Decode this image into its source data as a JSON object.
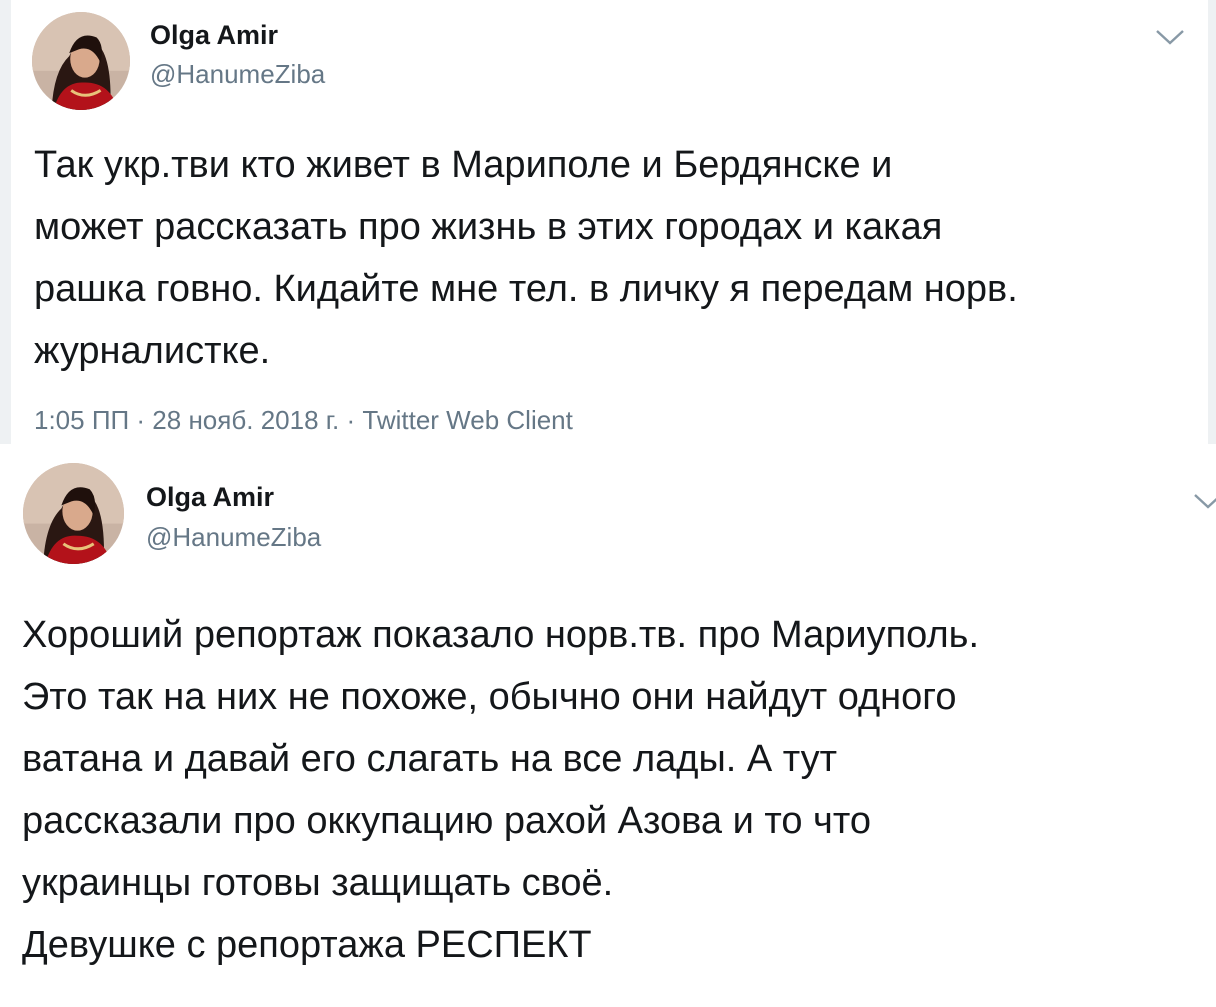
{
  "tweets": [
    {
      "author": {
        "name": "Olga Amir",
        "handle": "@HanumeZiba",
        "avatar_icon": "profile-photo"
      },
      "text": "Так укр.тви кто живет в Мариполе и Бердянске и\nможет рассказать про жизнь в этих городах и какая\nрашка говно. Кидайте мне тел. в личку я передам норв.\nжурналистке.",
      "meta": "1:05 ПП · 28 нояб. 2018 г. · Twitter Web Client",
      "menu_icon": "chevron-down-icon"
    },
    {
      "author": {
        "name": "Olga Amir",
        "handle": "@HanumeZiba",
        "avatar_icon": "profile-photo"
      },
      "text": "Хороший репортаж показало норв.тв. про Мариуполь.\nЭто так на них не похоже, обычно они найдут одного\nватана и давай его слагать на все лады. А тут\nрассказали про оккупацию рахой Азова и то что\nукраинцы готовы защищать своё.\nДевушке с репортажа РЕСПЕКТ",
      "menu_icon": "chevron-down-icon"
    }
  ],
  "colors": {
    "text": "#14171a",
    "secondary": "#657786",
    "background": "#ffffff",
    "edge": "#eef1f3"
  }
}
